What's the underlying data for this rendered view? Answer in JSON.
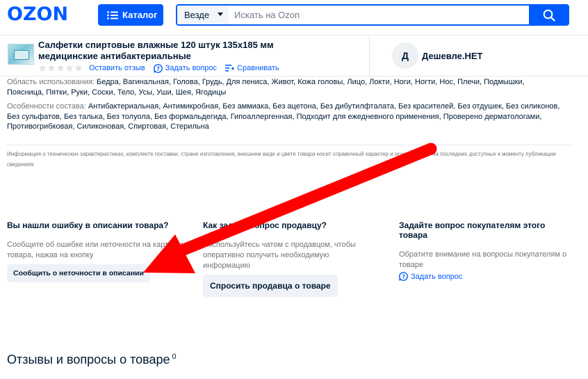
{
  "header": {
    "logo": "OZON",
    "catalog_label": "Каталог",
    "search_scope": "Везде",
    "search_placeholder": "Искать на Ozon"
  },
  "product": {
    "title": "Салфетки спиртовые влажные 120 штук 135x185 мм медицинские антибактериальные",
    "leave_review": "Оставить отзыв",
    "ask_question": "Задать вопрос",
    "compare": "Сравнивать",
    "rating_stars": 0
  },
  "seller": {
    "avatar_letter": "Д",
    "name": "Дешевле.НЕТ"
  },
  "specs": {
    "usage_label": "Область использования:",
    "usage_value": "Бедра, Вагинальная, Голова, Грудь, Для пениса, Живот, Кожа головы, Лицо, Локти, Ноги, Ногти, Нос, Плечи, Подмышки, Поясница, Пятки, Руки, Соски, Тело, Усы, Уши, Шея, Ягодицы",
    "composition_label": "Особенности состава:",
    "composition_value": "Антибактериальная, Антимикробная, Без аммиака, Без ацетона, Без дибутилфталата, Без красителей, Без отдушек, Без силиконов, Без сульфатов, Без талька, Без толуола, Без формальдегида, Гипоаллергенная, Подходит для ежедневного применения, Проверено дерматологами, Противогрибковая, Силиконовая, Спиртовая, Стерильна"
  },
  "disclaimer": "Информация о технических характеристиках, комплекте поставки, стране изготовления, внешнем виде и цвете товара носит справочный характер и основывается на последних доступных к моменту публикации сведениях",
  "help": {
    "error": {
      "title": "Вы нашли ошибку в описании товара?",
      "text": "Сообщите об ошибке или неточности на карточке товара, нажав на кнопку",
      "button": "Сообщить о неточности в описании"
    },
    "seller": {
      "title": "Как задать вопрос продавцу?",
      "text": "Воспользуйтесь чатом с продавцом, чтобы оперативно получить необходимую информацию",
      "button": "Спросить продавца о товаре"
    },
    "buyers": {
      "title": "Задайте вопрос покупателям этого товара",
      "text": "Обратите внимание на вопросы покупателям о товаре",
      "link": "Задать вопрос"
    }
  },
  "reviews": {
    "title": "Отзывы и вопросы о товаре",
    "count": "0"
  },
  "colors": {
    "brand": "#005bff",
    "annotation_arrow": "#ff0000"
  }
}
